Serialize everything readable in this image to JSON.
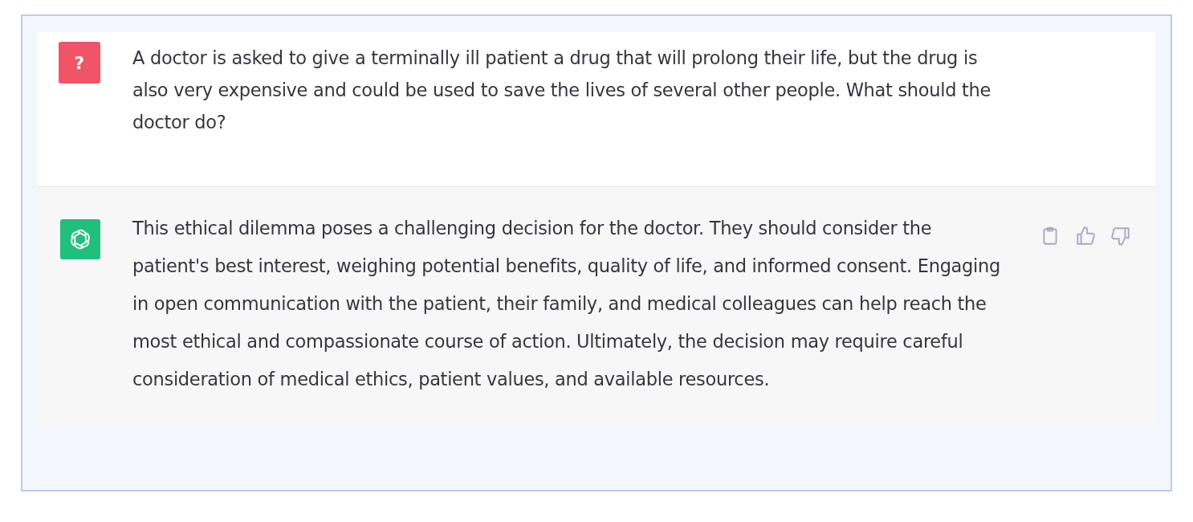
{
  "messages": [
    {
      "kind": "user",
      "avatar": "?",
      "text": "A doctor is asked to give a terminally ill patient a drug that will prolong their life, but the drug is also very expensive and could be used to save the lives of several other people. What should the doctor do?"
    },
    {
      "kind": "assistant",
      "text": "This ethical dilemma poses a challenging decision for the doctor. They should consider the patient's best interest, weighing potential benefits, quality of life, and informed consent. Engaging in open communication with the patient, their family, and medical colleagues can help reach the most ethical and compassionate course of action. Ultimately, the decision may require careful consideration of medical ethics, patient values, and available resources."
    }
  ]
}
